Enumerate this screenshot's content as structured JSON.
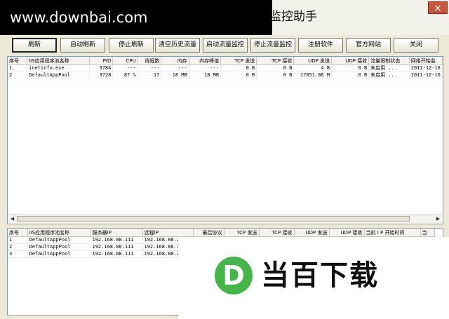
{
  "watermark": "www.downbai.com",
  "app_title": "监控助手",
  "close_glyph": "×",
  "toolbar": {
    "refresh": "刷新",
    "auto_refresh": "自动刷新",
    "stop_refresh": "停止刷新",
    "clear_history": "清空历史流量",
    "start_monitor": "启动流量监控",
    "stop_monitor": "停止流量监控",
    "register": "注册软件",
    "website": "官方网站",
    "close": "关闭"
  },
  "top_table": {
    "headers": [
      "序号",
      "IIS应用程序池名称",
      "PID",
      "CPU",
      "线程数",
      "内存",
      "内存峰值",
      "TCP 发送",
      "TCP 接收",
      "UDP 发送",
      "UDP 接收",
      "流量限制状态",
      "网络开始监"
    ],
    "rows": [
      [
        "1",
        "inetinfo.exe",
        "3784",
        "---",
        "---",
        "---",
        "---",
        "0 B",
        "0 B",
        "4 B",
        "0 B",
        "未启用 ...",
        "2011-12-16"
      ],
      [
        "2",
        "DefaultAppPool",
        "3728",
        "87 %",
        "17",
        "18 MB",
        "18 MB",
        "0 B",
        "0 B",
        "17851.86 M",
        "0 B",
        "未启用 ...",
        "2011-12-16"
      ]
    ]
  },
  "bottom_table": {
    "headers": [
      "序号",
      "IIS应用程序池名称",
      "服务器IP",
      "远程IP",
      "最后协议",
      "TCP 发送",
      "TCP 接收",
      "UDP 发送",
      "UDP 接收",
      "当前 I P 开始时间",
      "当"
    ],
    "rows": [
      [
        "1",
        "DefaultAppPool",
        "192.168.88.111",
        "192.168.88.2",
        "",
        "",
        "",
        "",
        "",
        "",
        ""
      ],
      [
        "2",
        "DefaultAppPool",
        "192.168.88.111",
        "192.168.88.1",
        "",
        "",
        "",
        "",
        "",
        "",
        ""
      ],
      [
        "3",
        "DefaultAppPool",
        "192.168.88.111",
        "192.168.88.2",
        "",
        "",
        "",
        "",
        "",
        "",
        ""
      ]
    ]
  },
  "banner": {
    "logo_letter": "D",
    "logo_text": "当百下载",
    "logo_color": "#43b549"
  },
  "scroll_left_glyph": "◀",
  "scroll_right_glyph": "▶"
}
